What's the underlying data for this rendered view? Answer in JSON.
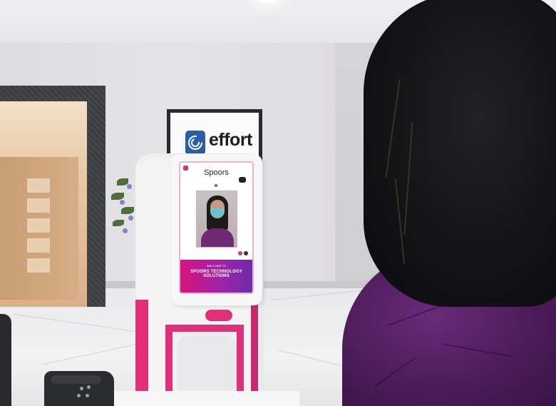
{
  "sign": {
    "brand_text": "effort",
    "logo_icon": "spoors-c-logo-icon",
    "brand_color": "#2a5fa8"
  },
  "kiosk": {
    "accent_color": "#e0307a",
    "screen": {
      "brand_name": "Spoors",
      "welcome_text": "WELCOME TO",
      "company_name": "SPOORS TECHNOLOGY SOLUTIONS",
      "banner_colors": [
        "#d6137e",
        "#6f2aa8"
      ]
    }
  }
}
